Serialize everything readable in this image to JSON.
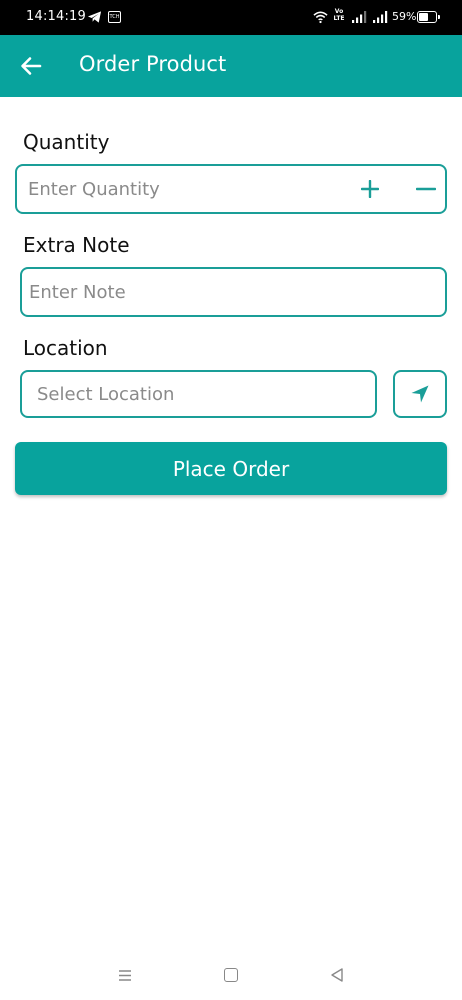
{
  "status_bar": {
    "time": "14:14:19",
    "notification_badge": "TCH",
    "network_label": "Vo LTE",
    "battery_percent": "59%",
    "battery_level": 0.59
  },
  "app_bar": {
    "back_icon": "arrow-left-icon",
    "title": "Order Product"
  },
  "form": {
    "quantity": {
      "label": "Quantity",
      "placeholder": "Enter Quantity",
      "value": "",
      "increment_icon": "plus-icon",
      "decrement_icon": "minus-icon"
    },
    "extra_note": {
      "label": "Extra Note",
      "placeholder": "Enter Note",
      "value": ""
    },
    "location": {
      "label": "Location",
      "placeholder": "Select Location",
      "value": "",
      "locate_icon": "navigation-arrow-icon"
    },
    "submit_label": "Place Order"
  },
  "colors": {
    "primary": "#08a39d",
    "border": "#1a9e98",
    "placeholder": "#8a8a8a"
  },
  "nav_bar": {
    "icons": [
      "menu-icon",
      "home-icon",
      "back-triangle-icon"
    ]
  }
}
